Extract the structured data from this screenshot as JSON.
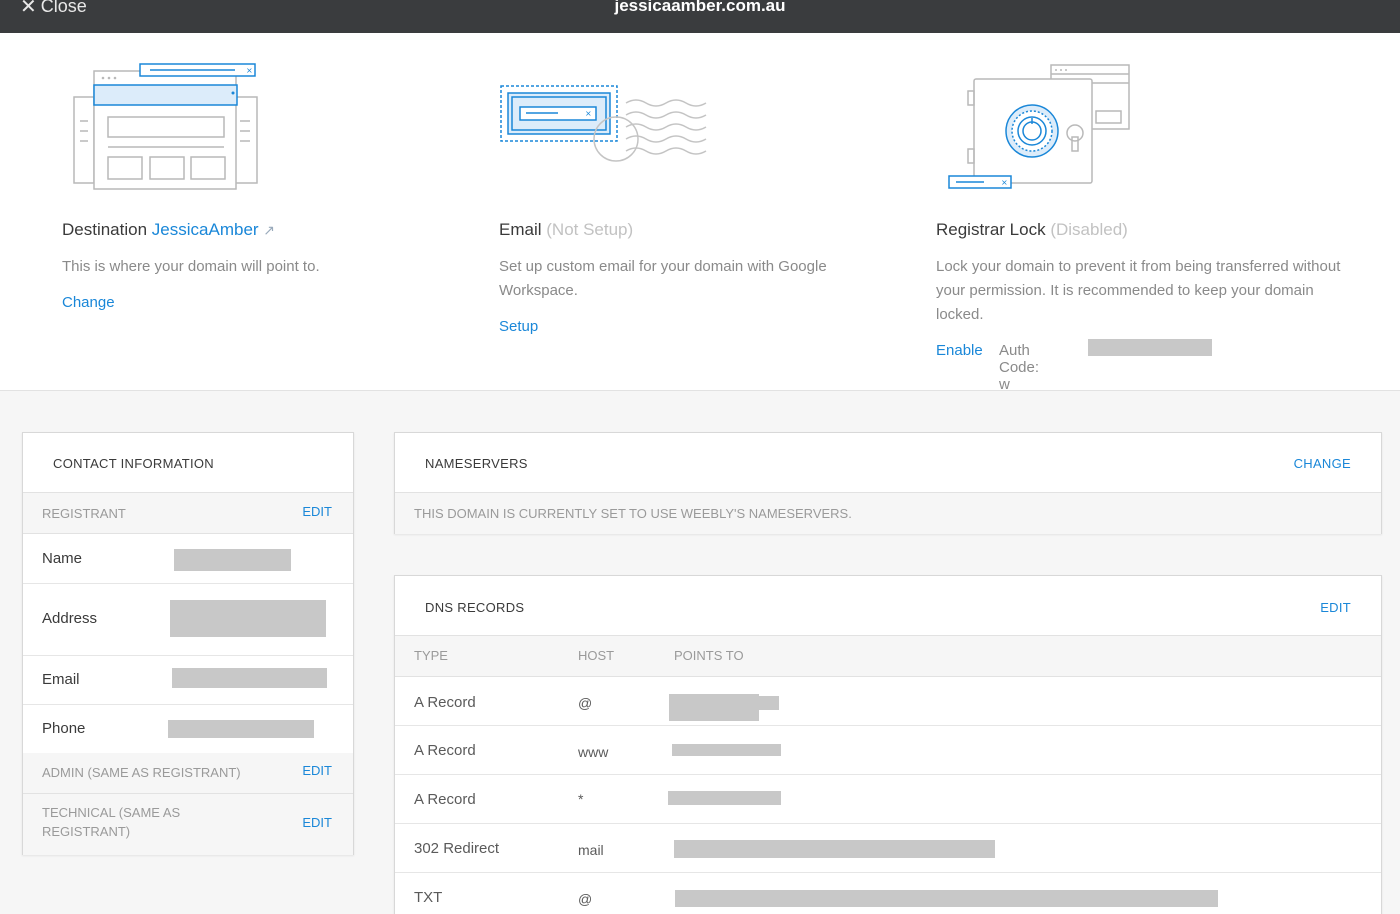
{
  "topbar": {
    "close_label": "Close",
    "domain": "jessicaamber.com.au"
  },
  "destination": {
    "title": "Destination",
    "site_name": "JessicaAmber",
    "external_icon": "external-link-icon",
    "description": "This is where your domain will point to.",
    "action": "Change"
  },
  "email": {
    "title": "Email",
    "status": "(Not Setup)",
    "description": "Set up custom email for your domain with Google Workspace.",
    "action": "Setup"
  },
  "lock": {
    "title": "Registrar Lock",
    "status": "(Disabled)",
    "description": "Lock your domain to prevent it from being transferred without your permission. It is recommended to keep your domain locked.",
    "action": "Enable",
    "auth_label": "Auth Code: w"
  },
  "contact": {
    "title": "CONTACT INFORMATION",
    "registrant_label": "REGISTRANT",
    "edit": "EDIT",
    "fields": [
      "Name",
      "Address",
      "Email",
      "Phone"
    ],
    "admin_label": "ADMIN (SAME AS REGISTRANT)",
    "technical_label": "TECHNICAL (SAME AS REGISTRANT)"
  },
  "nameservers": {
    "title": "NAMESERVERS",
    "action": "CHANGE",
    "note": "THIS DOMAIN IS CURRENTLY SET TO USE WEEBLY'S NAMESERVERS."
  },
  "dns": {
    "title": "DNS RECORDS",
    "action": "EDIT",
    "columns": [
      "TYPE",
      "HOST",
      "POINTS TO"
    ],
    "rows": [
      {
        "type": "A Record",
        "host": "@"
      },
      {
        "type": "A Record",
        "host": "www"
      },
      {
        "type": "A Record",
        "host": "*"
      },
      {
        "type": "302 Redirect",
        "host": "mail"
      },
      {
        "type": "TXT",
        "host": "@"
      }
    ]
  },
  "colors": {
    "accent": "#1a87d8",
    "topbar": "#3a3c3e",
    "muted": "#8a8a8a"
  }
}
